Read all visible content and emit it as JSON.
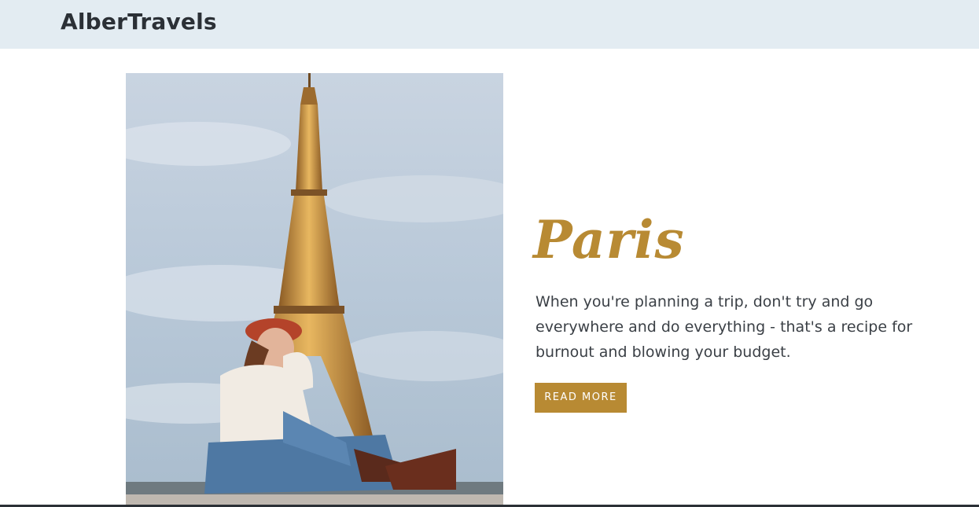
{
  "header": {
    "brand": "AlberTravels"
  },
  "hero": {
    "image_subject": "woman-sitting-before-eiffel-tower-photo",
    "title": "Paris",
    "description": "When you're planning a trip, don't try and go everywhere and do everything - that's a recipe for burnout and blowing your budget.",
    "button_label": "READ MORE"
  },
  "colors": {
    "accent": "#b88a33",
    "header_bg": "#e3ecf2",
    "text": "#3b4046",
    "brand_text": "#2b3036"
  }
}
